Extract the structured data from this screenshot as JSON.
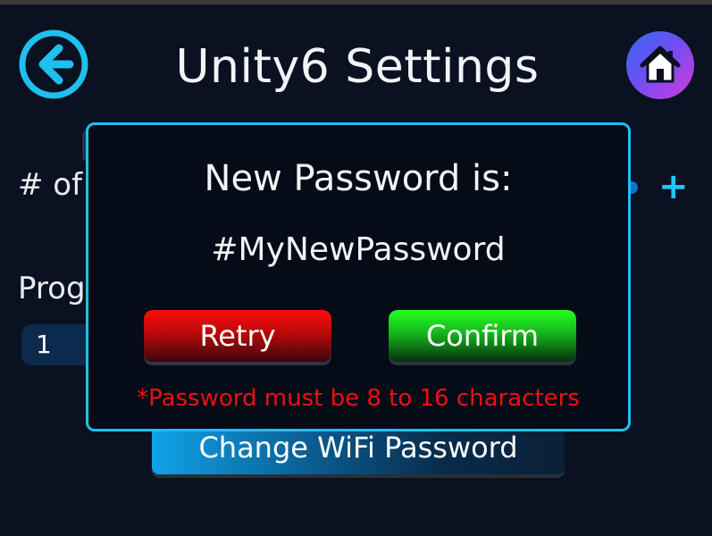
{
  "header": {
    "title": "Unity6 Settings",
    "back_icon": "arrow-left-circle-icon",
    "home_icon": "home-icon"
  },
  "background": {
    "count_label": "# of",
    "program_label": "Prog",
    "program_value": "1",
    "plus_label": "+",
    "wifi_button_label": "Change WiFi Password"
  },
  "modal": {
    "title": "New Password is:",
    "password": "#MyNewPassword",
    "retry_label": "Retry",
    "confirm_label": "Confirm",
    "error": "*Password must be 8 to 16 characters"
  },
  "colors": {
    "accent": "#1ec0ef",
    "retry": "#ff0d0d",
    "confirm": "#23ff23",
    "error": "#ee1010",
    "background": "#0a1120"
  }
}
